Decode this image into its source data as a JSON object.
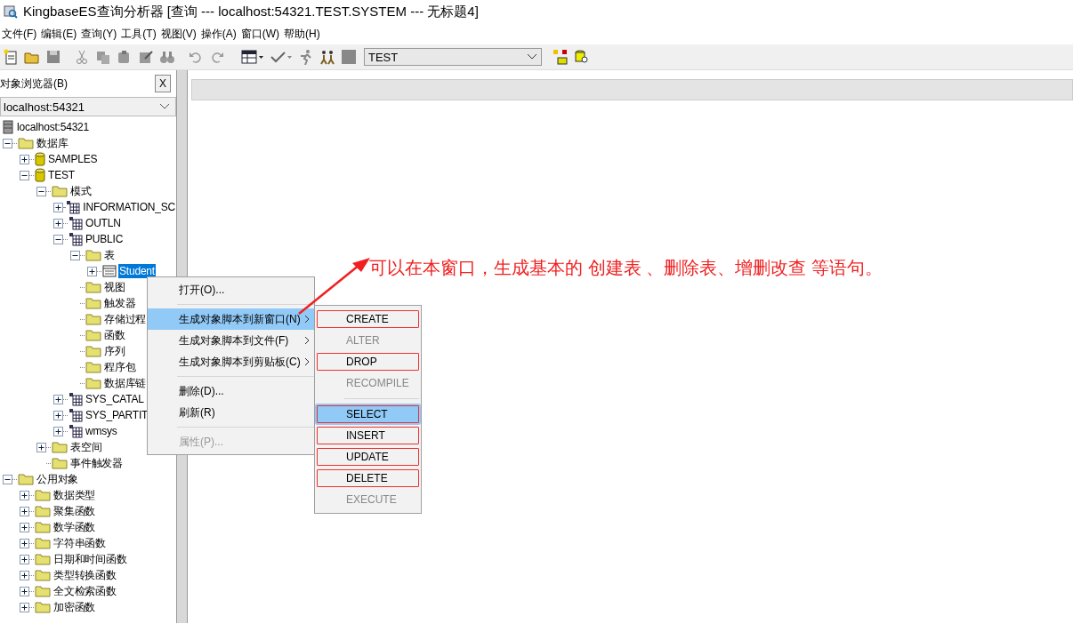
{
  "window": {
    "title": "KingbaseES查询分析器  [查询  ---  localhost:54321.TEST.SYSTEM  ---  无标题4]"
  },
  "menu_bar": [
    "文件(F)",
    "编辑(E)",
    "查询(Y)",
    "工具(T)",
    "视图(V)",
    "操作(A)",
    "窗口(W)",
    "帮助(H)"
  ],
  "toolbar": {
    "database": "TEST"
  },
  "object_browser": {
    "title": "对象浏览器(B)",
    "close": "X",
    "connection": "localhost:54321",
    "tree": [
      {
        "label": "localhost:54321",
        "kind": "server",
        "children": [
          {
            "label": "数据库",
            "kind": "folder",
            "expanded": true,
            "children": [
              {
                "label": "SAMPLES",
                "kind": "database",
                "expanded": false
              },
              {
                "label": "TEST",
                "kind": "database",
                "expanded": true,
                "children": [
                  {
                    "label": "模式",
                    "kind": "folder",
                    "expanded": true,
                    "children": [
                      {
                        "label": "INFORMATION_SC",
                        "kind": "schema",
                        "expanded": false
                      },
                      {
                        "label": "OUTLN",
                        "kind": "schema",
                        "expanded": false
                      },
                      {
                        "label": "PUBLIC",
                        "kind": "schema",
                        "expanded": true,
                        "children": [
                          {
                            "label": "表",
                            "kind": "folder",
                            "expanded": true,
                            "children": [
                              {
                                "label": "Student",
                                "kind": "table",
                                "expanded": false,
                                "selected": true
                              }
                            ]
                          },
                          {
                            "label": "视图",
                            "kind": "folder",
                            "selected": false
                          },
                          {
                            "label": "触发器",
                            "kind": "folder",
                            "selected": false
                          },
                          {
                            "label": "存储过程",
                            "kind": "folder",
                            "selected": false
                          },
                          {
                            "label": "函数",
                            "kind": "folder",
                            "selected": false
                          },
                          {
                            "label": "序列",
                            "kind": "folder",
                            "selected": false
                          },
                          {
                            "label": "程序包",
                            "kind": "folder",
                            "selected": false
                          },
                          {
                            "label": "数据库链",
                            "kind": "folder",
                            "selected": false
                          }
                        ]
                      },
                      {
                        "label": "SYS_CATAL",
                        "kind": "schema",
                        "expanded": false
                      },
                      {
                        "label": "SYS_PARTIT",
                        "kind": "schema",
                        "expanded": false
                      },
                      {
                        "label": "wmsys",
                        "kind": "schema",
                        "expanded": false
                      }
                    ]
                  },
                  {
                    "label": "表空间",
                    "kind": "folder",
                    "expanded": false
                  },
                  {
                    "label": "事件触发器",
                    "kind": "folder"
                  }
                ]
              }
            ]
          },
          {
            "label": "公用对象",
            "kind": "folder",
            "expanded": true,
            "children": [
              {
                "label": "数据类型",
                "kind": "folder",
                "expanded": false
              },
              {
                "label": "聚集函数",
                "kind": "folder",
                "expanded": false
              },
              {
                "label": "数学函数",
                "kind": "folder",
                "expanded": false
              },
              {
                "label": "字符串函数",
                "kind": "folder",
                "expanded": false
              },
              {
                "label": "日期和时间函数",
                "kind": "folder",
                "expanded": false
              },
              {
                "label": "类型转换函数",
                "kind": "folder",
                "expanded": false
              },
              {
                "label": "全文检索函数",
                "kind": "folder",
                "expanded": false
              },
              {
                "label": "加密函数",
                "kind": "folder",
                "expanded": false
              }
            ]
          }
        ]
      }
    ]
  },
  "context_menu": [
    {
      "kind": "item",
      "label": "打开(O)...",
      "selected": false,
      "disabled": false
    },
    {
      "kind": "separator"
    },
    {
      "kind": "submenu",
      "label": "生成对象脚本到新窗口(N)",
      "selected": true,
      "disabled": false
    },
    {
      "kind": "submenu",
      "label": "生成对象脚本到文件(F)",
      "selected": false,
      "disabled": false
    },
    {
      "kind": "submenu",
      "label": "生成对象脚本到剪贴板(C)",
      "selected": false,
      "disabled": false
    },
    {
      "kind": "separator"
    },
    {
      "kind": "item",
      "label": "删除(D)...",
      "selected": false,
      "disabled": false
    },
    {
      "kind": "item",
      "label": "刷新(R)",
      "selected": false,
      "disabled": false
    },
    {
      "kind": "separator"
    },
    {
      "kind": "item",
      "label": "属性(P)...",
      "selected": false,
      "disabled": true
    }
  ],
  "submenu": [
    {
      "kind": "item",
      "label": "CREATE",
      "selected": false,
      "disabled": false,
      "circled": true
    },
    {
      "kind": "item",
      "label": "ALTER",
      "selected": false,
      "disabled": true,
      "circled": false
    },
    {
      "kind": "item",
      "label": "DROP",
      "selected": false,
      "disabled": false,
      "circled": true
    },
    {
      "kind": "item",
      "label": "RECOMPILE",
      "selected": false,
      "disabled": true,
      "circled": false
    },
    {
      "kind": "separator"
    },
    {
      "kind": "item",
      "label": "SELECT",
      "selected": true,
      "disabled": false,
      "circled": true
    },
    {
      "kind": "item",
      "label": "INSERT",
      "selected": false,
      "disabled": false,
      "circled": true
    },
    {
      "kind": "item",
      "label": "UPDATE",
      "selected": false,
      "disabled": false,
      "circled": true
    },
    {
      "kind": "item",
      "label": "DELETE",
      "selected": false,
      "disabled": false,
      "circled": true
    },
    {
      "kind": "item",
      "label": "EXECUTE",
      "selected": false,
      "disabled": true,
      "circled": false
    }
  ],
  "annotation": {
    "text": "可以在本窗口，生成基本的 创建表 、删除表、增删改查 等语句。"
  }
}
